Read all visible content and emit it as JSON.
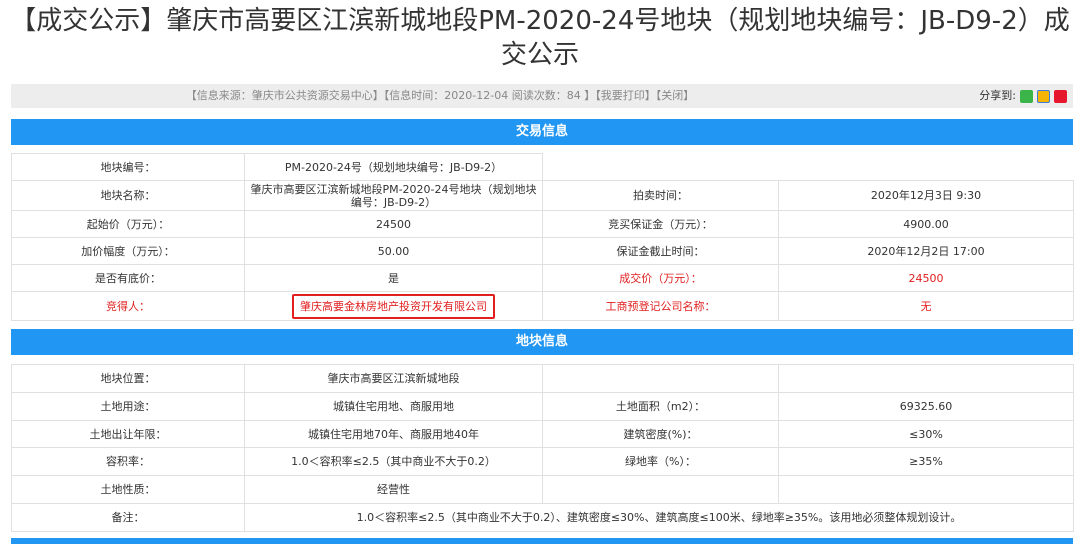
{
  "page_title": "【成交公示】肇庆市高要区江滨新城地段PM-2020-24号地块（规划地块编号：JB-D9-2）成交公示",
  "infobar": {
    "meta": "【信息来源：肇庆市公共资源交易中心】【信息时间：2020-12-04 阅读次数：84 】【我要打印】【关闭】",
    "share_label": "分享到:"
  },
  "icons": [
    "wechat-icon",
    "qzone-icon",
    "weibo-icon"
  ],
  "colors": {
    "section_header": "#2196f3",
    "highlight": "#e02020"
  },
  "trade_section": {
    "header": "交易信息",
    "rows": [
      {
        "l1": "地块编号：",
        "v1": "PM-2020-24号（规划地块编号：JB-D9-2）",
        "l2": "",
        "v2": ""
      },
      {
        "l1": "地块名称：",
        "v1": "肇庆市高要区江滨新城地段PM-2020-24号地块（规划地块编号：JB-D9-2）",
        "l2": "拍卖时间：",
        "v2": "2020年12月3日 9:30"
      },
      {
        "l1": "起始价（万元）：",
        "v1": "24500",
        "l2": "竞买保证金（万元）：",
        "v2": "4900.00"
      },
      {
        "l1": "加价幅度（万元）：",
        "v1": "50.00",
        "l2": "保证金截止时间：",
        "v2": "2020年12月2日 17:00"
      },
      {
        "l1": "是否有底价：",
        "v1": "是",
        "l2": "成交价（万元）：",
        "v2": "24500"
      },
      {
        "l1": "竞得人：",
        "v1": "肇庆高要金林房地产投资开发有限公司",
        "l2": "工商预登记公司名称：",
        "v2": "无"
      }
    ]
  },
  "land_section": {
    "header": "地块信息",
    "rows": [
      {
        "l1": "地块位置：",
        "v1": "肇庆市高要区江滨新城地段",
        "l2": "",
        "v2": ""
      },
      {
        "l1": "土地用途：",
        "v1": "城镇住宅用地、商服用地",
        "l2": "土地面积（m2）：",
        "v2": "69325.60"
      },
      {
        "l1": "土地出让年限：",
        "v1": "城镇住宅用地70年、商服用地40年",
        "l2": "建筑密度(%)：",
        "v2": "≤30%"
      },
      {
        "l1": "容积率：",
        "v1": "1.0＜容积率≤2.5（其中商业不大于0.2）",
        "l2": "绿地率（%）：",
        "v2": "≥35%"
      },
      {
        "l1": "土地性质：",
        "v1": "经营性",
        "l2": "",
        "v2": ""
      }
    ],
    "remark_label": "备注：",
    "remark_value": "1.0＜容积率≤2.5（其中商业不大于0.2）、建筑密度≤30%、建筑高度≤100米、绿地率≥35%。该用地必须整体规划设计。"
  }
}
